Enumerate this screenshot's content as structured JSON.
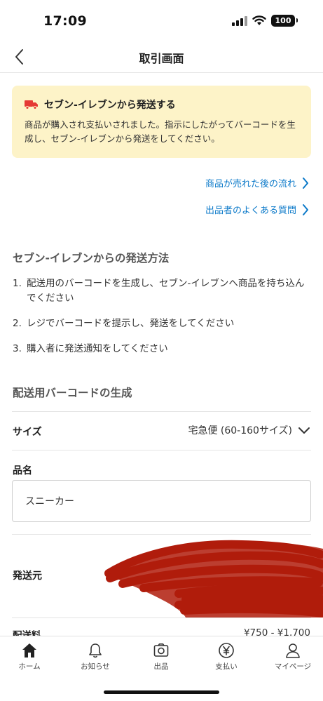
{
  "status_bar": {
    "time": "17:09",
    "battery": "100"
  },
  "nav": {
    "title": "取引画面"
  },
  "notice": {
    "title": "セブン-イレブンから発送する",
    "body": "商品が購入され支払いされました。指示にしたがってバーコードを生成し、セブン-イレブンから発送をしてください。",
    "icon": "truck-icon",
    "accent": "#e53935"
  },
  "links": [
    {
      "label": "商品が売れた後の流れ"
    },
    {
      "label": "出品者のよくある質問"
    }
  ],
  "shipping_method": {
    "title": "セブン-イレブンからの発送方法",
    "steps": [
      {
        "num": "1.",
        "text": "配送用のバーコードを生成し、セブン-イレブンへ商品を持ち込んでください"
      },
      {
        "num": "2.",
        "text": "レジでバーコードを提示し、発送をしてください"
      },
      {
        "num": "3.",
        "text": "購入者に発送通知をしてください"
      }
    ]
  },
  "barcode": {
    "title": "配送用バーコードの生成",
    "size_label": "サイズ",
    "size_value": "宅急便 (60-160サイズ)",
    "item_name_label": "品名",
    "item_name_value": "スニーカー",
    "origin_label": "発送元",
    "fee_label": "配送料",
    "fee_value": "¥750 - ¥1,700"
  },
  "tabs": [
    {
      "label": "ホーム",
      "icon": "home-icon",
      "active": true
    },
    {
      "label": "お知らせ",
      "icon": "bell-icon",
      "active": false
    },
    {
      "label": "出品",
      "icon": "camera-icon",
      "active": false
    },
    {
      "label": "支払い",
      "icon": "yen-circle-icon",
      "active": false
    },
    {
      "label": "マイページ",
      "icon": "user-icon",
      "active": false
    }
  ],
  "colors": {
    "link": "#0b79c9",
    "notice_bg": "#fdf3c8",
    "redaction": "#b01c0c"
  }
}
